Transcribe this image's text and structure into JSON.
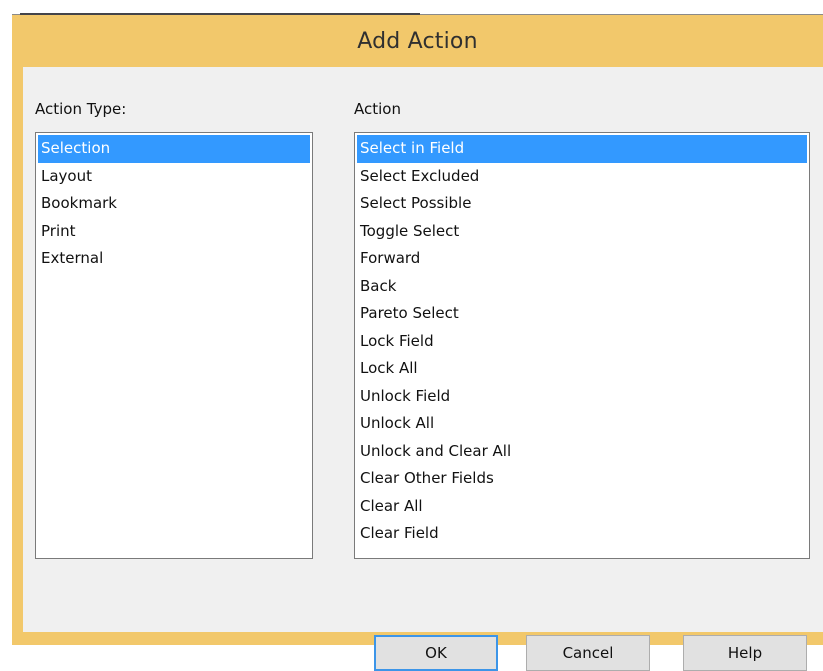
{
  "dialog": {
    "title": "Add Action"
  },
  "action_type": {
    "label": "Action Type:",
    "items": [
      "Selection",
      "Layout",
      "Bookmark",
      "Print",
      "External"
    ],
    "selected": "Selection"
  },
  "action": {
    "label": "Action",
    "items": [
      "Select in Field",
      "Select Excluded",
      "Select Possible",
      "Toggle Select",
      "Forward",
      "Back",
      "Pareto Select",
      "Lock Field",
      "Lock All",
      "Unlock Field",
      "Unlock All",
      "Unlock and Clear All",
      "Clear Other Fields",
      "Clear All",
      "Clear Field"
    ],
    "selected": "Select in Field"
  },
  "buttons": {
    "ok": "OK",
    "cancel": "Cancel",
    "help": "Help"
  },
  "colors": {
    "frame": "#f2c86b",
    "selection": "#3399ff",
    "default_button_border": "#3c95e8"
  }
}
